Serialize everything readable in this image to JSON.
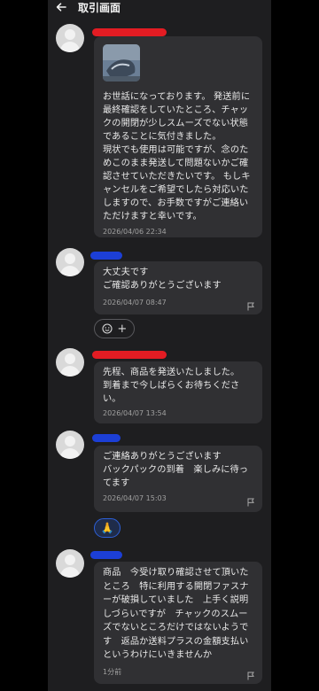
{
  "header": {
    "title": "取引画面",
    "back_icon": "arrow-left-icon"
  },
  "messages": [
    {
      "text": "お世話になっております。 発送前に最終確認をしていたところ、チャックの開閉が少しスムーズでない状態であることに気付きました。\n現状でも使用は可能ですが、念のためこのまま発送して問題ないかご確認させていただきたいです。 もしキャンセルをご希望でしたら対応いたしますので、お手数ですがご連絡いただけますと幸いです。",
      "timestamp": "2026/04/06 22:34"
    },
    {
      "text": "大丈夫です\nご確認ありがとうございます",
      "timestamp": "2026/04/07 08:47"
    },
    {
      "text": "先程、商品を発送いたしました。\n到着まで今しばらくお待ちください。",
      "timestamp": "2026/04/07 13:54"
    },
    {
      "text": "ご連絡ありがとうございます\nバックパックの到着　楽しみに待ってます",
      "timestamp": "2026/04/07 15:03"
    },
    {
      "text": "商品　今受け取り確認させて頂いたところ　特に利用する開閉ファスナーが破損していました　上手く説明しづらいですが　チャックのスムーズでないところだけではないようです　返品か送料プラスの金額支払いというわけにいきませんか",
      "timestamp": "1分前"
    }
  ],
  "reactions": {
    "smile_icon": "smile-plus-icon",
    "add_symbol": "+",
    "pray_emoji": "🙏"
  },
  "colors": {
    "seller_name_mask": "#e31c23",
    "buyer_name_mask": "#1c3fd6",
    "bubble": "#303033",
    "background": "#1e1e20"
  }
}
